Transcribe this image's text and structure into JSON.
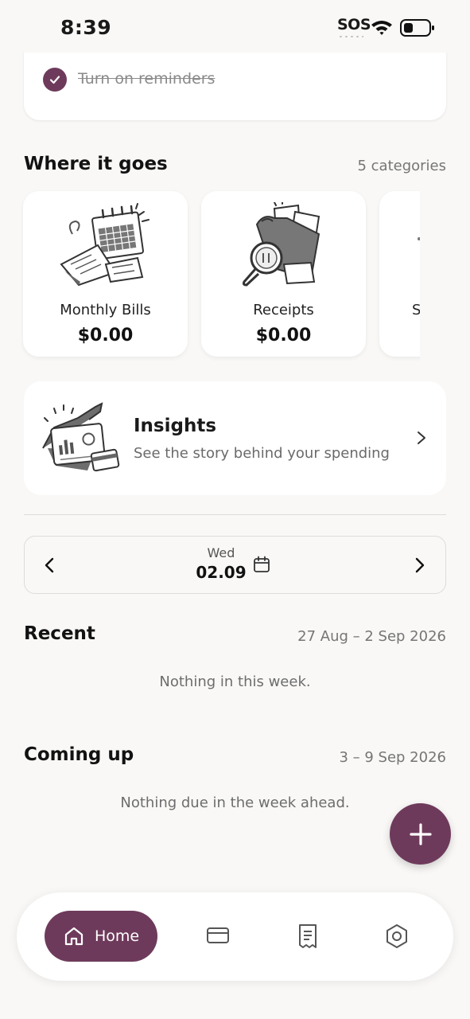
{
  "status_bar": {
    "time": "8:39",
    "sos": "SOS"
  },
  "reminder": {
    "label": "Turn on reminders",
    "checked": true
  },
  "where_it_goes": {
    "title": "Where it goes",
    "count_label": "5 categories",
    "categories": [
      {
        "name": "Monthly Bills",
        "amount": "$0.00",
        "icon": "calendar-bills-illustration"
      },
      {
        "name": "Receipts",
        "amount": "$0.00",
        "icon": "receipts-magnifier-illustration"
      },
      {
        "name": "S",
        "amount": "",
        "icon": "partial-category-illustration"
      }
    ]
  },
  "insights": {
    "title": "Insights",
    "subtitle": "See the story behind your spending",
    "icon": "insights-chart-illustration"
  },
  "date_nav": {
    "day": "Wed",
    "date": "02.09"
  },
  "recent": {
    "title": "Recent",
    "range": "27 Aug – 2 Sep 2026",
    "empty": "Nothing in this week."
  },
  "coming_up": {
    "title": "Coming up",
    "range": "3 – 9 Sep 2026",
    "empty": "Nothing due in the week ahead."
  },
  "bottom_nav": {
    "items": [
      {
        "label": "Home",
        "icon": "home-icon",
        "active": true
      },
      {
        "label": "",
        "icon": "card-icon",
        "active": false
      },
      {
        "label": "",
        "icon": "receipt-icon",
        "active": false
      },
      {
        "label": "",
        "icon": "settings-icon",
        "active": false
      }
    ]
  },
  "colors": {
    "accent": "#6e3a5b",
    "background": "#f9f8f6",
    "card": "#ffffff"
  }
}
